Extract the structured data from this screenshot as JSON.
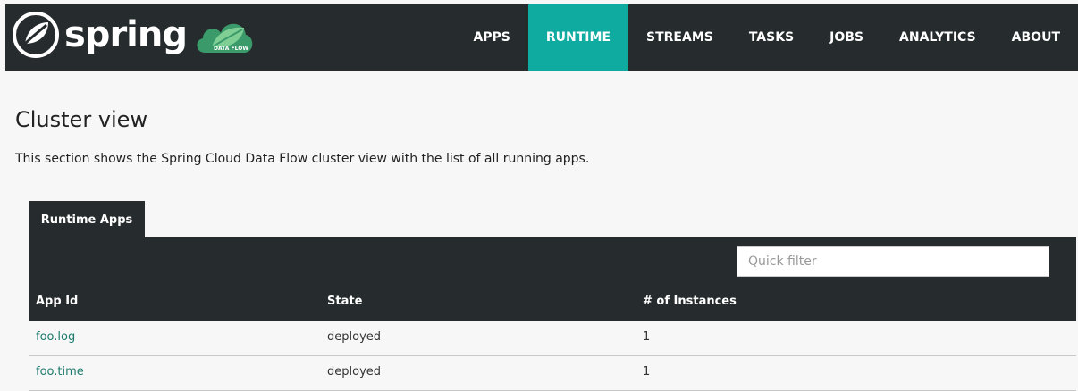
{
  "brand": {
    "name": "spring",
    "badge": "DATA FLOW",
    "colors": {
      "header_bg": "#262b2e",
      "accent": "#0faaa0",
      "link": "#1d7b6e"
    }
  },
  "nav": {
    "items": [
      {
        "label": "APPS",
        "active": false
      },
      {
        "label": "RUNTIME",
        "active": true
      },
      {
        "label": "STREAMS",
        "active": false
      },
      {
        "label": "TASKS",
        "active": false
      },
      {
        "label": "JOBS",
        "active": false
      },
      {
        "label": "ANALYTICS",
        "active": false
      },
      {
        "label": "ABOUT",
        "active": false
      }
    ]
  },
  "page": {
    "title": "Cluster view",
    "description": "This section shows the Spring Cloud Data Flow cluster view with the list of all running apps."
  },
  "tabs": [
    {
      "label": "Runtime Apps",
      "active": true
    }
  ],
  "filter": {
    "placeholder": "Quick filter",
    "value": ""
  },
  "table": {
    "headers": [
      "App Id",
      "State",
      "# of Instances"
    ],
    "rows": [
      {
        "app_id": "foo.log",
        "state": "deployed",
        "instances": "1"
      },
      {
        "app_id": "foo.time",
        "state": "deployed",
        "instances": "1"
      }
    ]
  }
}
